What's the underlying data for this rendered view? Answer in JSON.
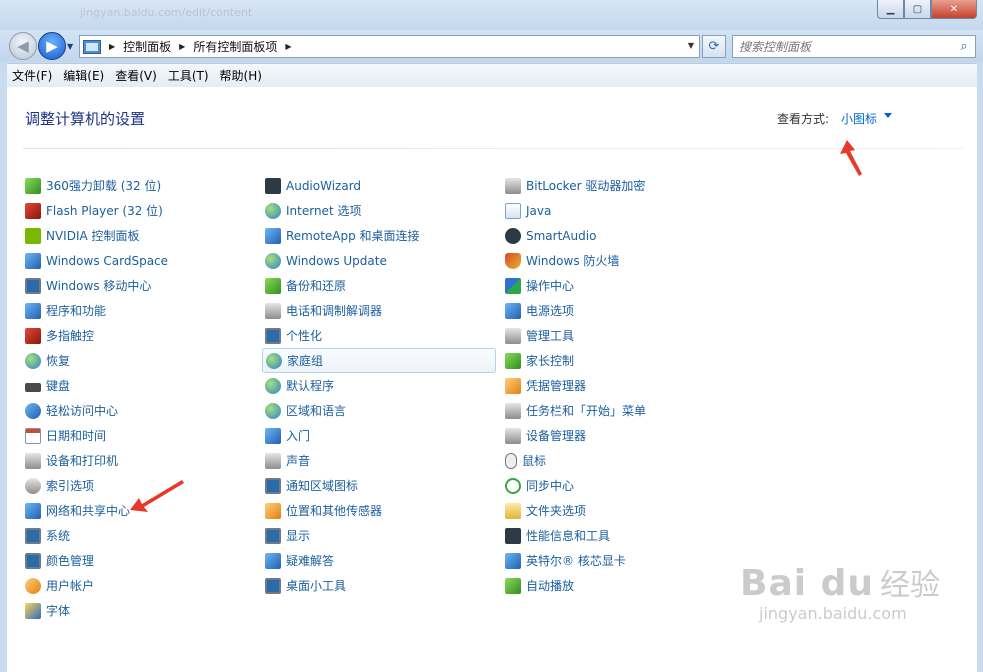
{
  "window": {
    "ghost_title": "jingyan.baidu.com/edit/content",
    "minimize_icon": "minimize-icon",
    "maximize_icon": "maximize-icon",
    "close_label": "✕"
  },
  "nav": {
    "back_icon": "back-arrow-icon",
    "forward_icon": "forward-arrow-icon",
    "breadcrumbs": [
      "控制面板",
      "所有控制面板项"
    ],
    "search_placeholder": "搜索控制面板"
  },
  "menu": [
    "文件(F)",
    "编辑(E)",
    "查看(V)",
    "工具(T)",
    "帮助(H)"
  ],
  "page": {
    "title": "调整计算机的设置",
    "view_by_label": "查看方式:",
    "view_by_value": "小图标"
  },
  "columns": [
    [
      {
        "label": "360强力卸载 (32 位)",
        "icon": "uninstall-icon"
      },
      {
        "label": "Flash Player (32 位)",
        "icon": "flash-icon"
      },
      {
        "label": "NVIDIA 控制面板",
        "icon": "nvidia-icon"
      },
      {
        "label": "Windows CardSpace",
        "icon": "cardspace-icon"
      },
      {
        "label": "Windows 移动中心",
        "icon": "mobility-center-icon"
      },
      {
        "label": "程序和功能",
        "icon": "programs-icon"
      },
      {
        "label": "多指触控",
        "icon": "touch-icon"
      },
      {
        "label": "恢复",
        "icon": "recovery-icon"
      },
      {
        "label": "键盘",
        "icon": "keyboard-icon"
      },
      {
        "label": "轻松访问中心",
        "icon": "ease-of-access-icon"
      },
      {
        "label": "日期和时间",
        "icon": "calendar-icon"
      },
      {
        "label": "设备和打印机",
        "icon": "printer-icon"
      },
      {
        "label": "索引选项",
        "icon": "search-index-icon"
      },
      {
        "label": "网络和共享中心",
        "icon": "network-icon"
      },
      {
        "label": "系统",
        "icon": "system-icon"
      },
      {
        "label": "颜色管理",
        "icon": "color-management-icon"
      },
      {
        "label": "用户帐户",
        "icon": "users-icon"
      },
      {
        "label": "字体",
        "icon": "fonts-icon"
      }
    ],
    [
      {
        "label": "AudioWizard",
        "icon": "audio-wizard-icon"
      },
      {
        "label": "Internet 选项",
        "icon": "internet-options-icon"
      },
      {
        "label": "RemoteApp 和桌面连接",
        "icon": "remoteapp-icon"
      },
      {
        "label": "Windows Update",
        "icon": "windows-update-icon"
      },
      {
        "label": "备份和还原",
        "icon": "backup-icon"
      },
      {
        "label": "电话和调制解调器",
        "icon": "phone-modem-icon"
      },
      {
        "label": "个性化",
        "icon": "personalization-icon"
      },
      {
        "label": "家庭组",
        "icon": "homegroup-icon"
      },
      {
        "label": "默认程序",
        "icon": "default-programs-icon"
      },
      {
        "label": "区域和语言",
        "icon": "region-language-icon"
      },
      {
        "label": "入门",
        "icon": "getting-started-icon"
      },
      {
        "label": "声音",
        "icon": "sound-icon"
      },
      {
        "label": "通知区域图标",
        "icon": "notification-icon"
      },
      {
        "label": "位置和其他传感器",
        "icon": "sensor-icon"
      },
      {
        "label": "显示",
        "icon": "display-icon"
      },
      {
        "label": "疑难解答",
        "icon": "troubleshooting-icon"
      },
      {
        "label": "桌面小工具",
        "icon": "gadgets-icon"
      }
    ],
    [
      {
        "label": "BitLocker 驱动器加密",
        "icon": "bitlocker-icon"
      },
      {
        "label": "Java",
        "icon": "java-icon"
      },
      {
        "label": "SmartAudio",
        "icon": "smartaudio-icon"
      },
      {
        "label": "Windows 防火墙",
        "icon": "firewall-icon"
      },
      {
        "label": "操作中心",
        "icon": "action-center-flag-icon"
      },
      {
        "label": "电源选项",
        "icon": "power-icon"
      },
      {
        "label": "管理工具",
        "icon": "admin-tools-icon"
      },
      {
        "label": "家长控制",
        "icon": "parental-controls-icon"
      },
      {
        "label": "凭据管理器",
        "icon": "credential-icon"
      },
      {
        "label": "任务栏和「开始」菜单",
        "icon": "taskbar-icon"
      },
      {
        "label": "设备管理器",
        "icon": "device-manager-icon"
      },
      {
        "label": "鼠标",
        "icon": "mouse-icon"
      },
      {
        "label": "同步中心",
        "icon": "sync-icon"
      },
      {
        "label": "文件夹选项",
        "icon": "folder-options-icon"
      },
      {
        "label": "性能信息和工具",
        "icon": "performance-icon"
      },
      {
        "label": "英特尔® 核芯显卡",
        "icon": "intel-graphics-icon"
      },
      {
        "label": "自动播放",
        "icon": "autoplay-icon"
      }
    ]
  ],
  "watermark": {
    "logo": "Bai du",
    "cn": "经验",
    "url": "jingyan.baidu.com"
  }
}
